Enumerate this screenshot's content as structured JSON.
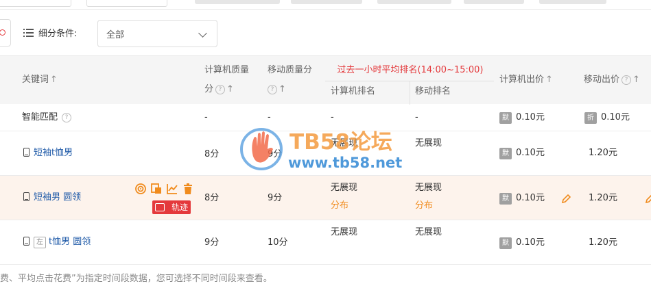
{
  "filter": {
    "label": "细分条件:",
    "select_value": "全部"
  },
  "header": {
    "keyword": "关键词",
    "pc_quality_line1": "计算机质量",
    "pc_quality_line2": "分",
    "mobile_quality": "移动质量分",
    "group_title": "过去一小时平均排名(14:00~15:00)",
    "pc_rank": "计算机排名",
    "mobile_rank": "移动排名",
    "pc_bid": "计算机出价",
    "mobile_bid": "移动出价",
    "sort_arrow": "↑"
  },
  "rows": [
    {
      "keyword": "智能匹配",
      "pc_quality": "-",
      "mobile_quality": "-",
      "pc_rank": "-",
      "mobile_rank": "-",
      "pc_bid_tag": "默",
      "pc_bid": "0.10元",
      "mobile_bid_tag": "折",
      "mobile_bid": "0.10元"
    },
    {
      "keyword": "短袖t恤男",
      "pc_quality": "8分",
      "mobile_quality": "9分",
      "pc_rank": "无展现",
      "mobile_rank": "无展现",
      "pc_bid_tag": "默",
      "pc_bid": "0.10元",
      "mobile_bid": "1.20元"
    },
    {
      "keyword": "短袖男 圆领",
      "pc_quality": "8分",
      "mobile_quality": "9分",
      "pc_rank": "无展现",
      "pc_rank_link": "分布",
      "mobile_rank": "无展现",
      "mobile_rank_link": "分布",
      "pc_bid_tag": "默",
      "pc_bid": "0.10元",
      "mobile_bid": "1.20元",
      "track_label": "轨迹"
    },
    {
      "keyword_tag": "左",
      "keyword": "t恤男 圆领",
      "pc_quality": "9分",
      "mobile_quality": "10分",
      "pc_rank": "无展现",
      "mobile_rank": "无展现",
      "pc_bid_tag": "默",
      "pc_bid": "0.10元",
      "mobile_bid": "1.20元"
    }
  ],
  "footer_note": "费、平均点击花费”为指定时间段数据，您可选择不同时间段来查看。",
  "watermark": {
    "title": "TB58论坛",
    "url": "www.tb58.net"
  },
  "colors": {
    "accent_red": "#e4393c",
    "link_blue": "#1f5aa8",
    "orange": "#f08b1d",
    "highlight_row": "#fdf3ec"
  }
}
